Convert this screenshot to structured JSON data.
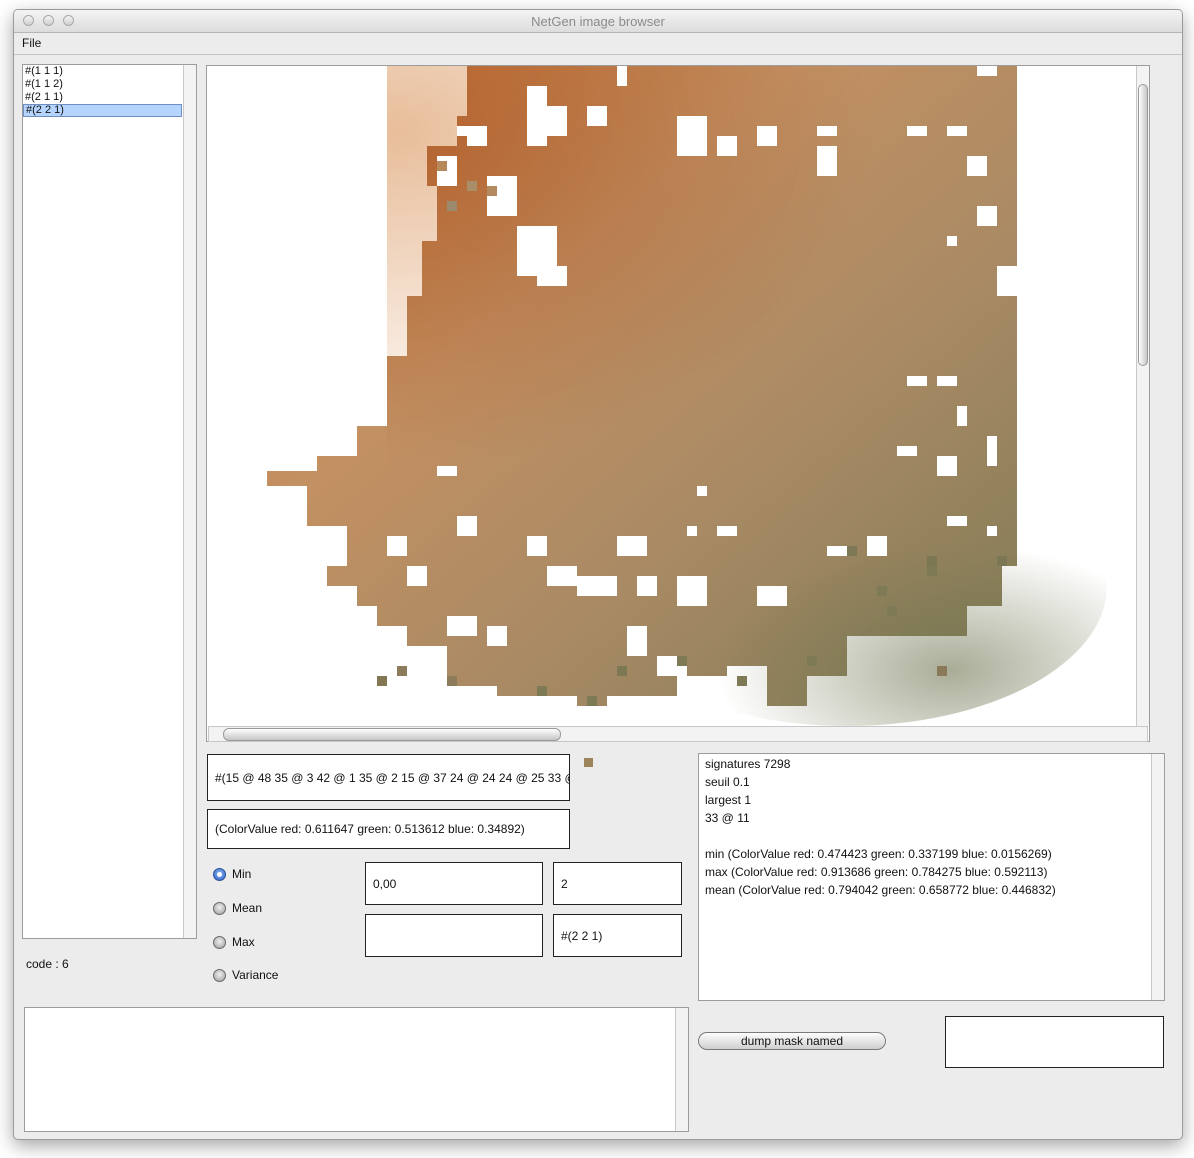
{
  "window": {
    "title": "NetGen image browser"
  },
  "menu": {
    "file": "File"
  },
  "mask_list": {
    "items": [
      "#(1 1 1)",
      "#(1 1 2)",
      "#(2 1 1)",
      "#(2 2 1)"
    ],
    "selected_index": 3
  },
  "code_label": "code : 6",
  "signature_field": "#(15 @ 48 35 @ 3 42 @ 1 35 @ 2 15 @ 37 24 @ 24 24 @ 25 33 @",
  "color_field": "(ColorValue red: 0.611647 green: 0.513612 blue: 0.34892)",
  "swatch_color": "#9c835a",
  "stats": {
    "options": [
      "Min",
      "Mean",
      "Max",
      "Variance"
    ],
    "selected": "Min"
  },
  "fields": {
    "threshold": "0,00",
    "level": "2",
    "empty": "",
    "mask_id": "#(2 2 1)"
  },
  "info": {
    "lines": [
      "signatures  7298",
      "seuil  0.1",
      "largest  1",
      "33 @ 11",
      "",
      "min (ColorValue red: 0.474423 green: 0.337199 blue: 0.0156269)",
      "max (ColorValue red: 0.913686 green: 0.784275 blue: 0.592113)",
      "mean (ColorValue red: 0.794042 green: 0.658772 blue: 0.446832)"
    ]
  },
  "dump_button": "dump mask named",
  "dump_name": "",
  "colors": {
    "selection": "#b5d5ff",
    "radio_on": "#2a5fc8",
    "terrain_orange": "#c9874a",
    "terrain_green": "#7e7a55"
  }
}
